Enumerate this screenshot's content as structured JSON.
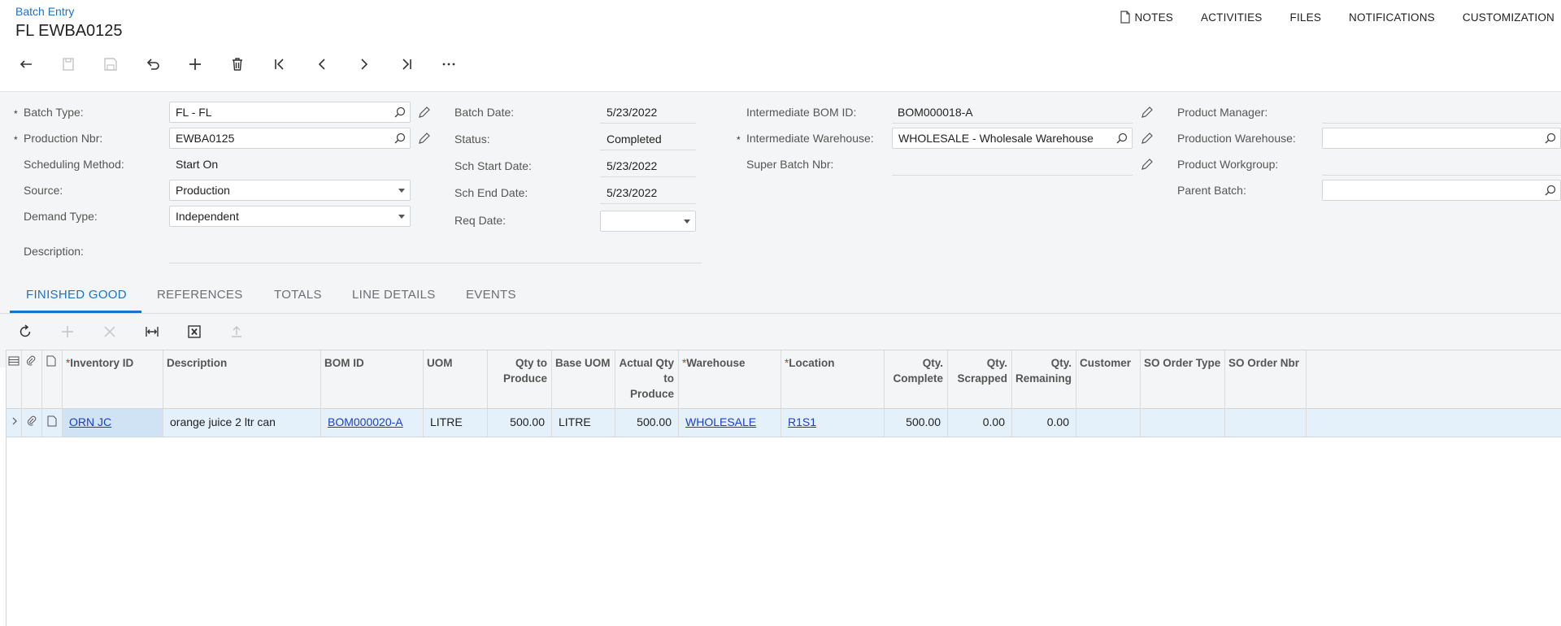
{
  "breadcrumb": "Batch Entry",
  "title": "FL EWBA0125",
  "top_menu": [
    "NOTES",
    "ACTIVITIES",
    "FILES",
    "NOTIFICATIONS",
    "CUSTOMIZATION"
  ],
  "toolbar_icons": [
    "back-icon",
    "copy-icon",
    "save-icon",
    "undo-icon",
    "add-icon",
    "delete-icon",
    "first-icon",
    "previous-icon",
    "next-icon",
    "last-icon",
    "more-icon"
  ],
  "form": {
    "col1": {
      "batch_type": {
        "label": "Batch Type:",
        "value": "FL - FL",
        "required": "*"
      },
      "production_nbr": {
        "label": "Production Nbr:",
        "value": "EWBA0125",
        "required": "*"
      },
      "scheduling_method": {
        "label": "Scheduling Method:",
        "value": "Start On"
      },
      "source": {
        "label": "Source:",
        "value": "Production"
      },
      "demand_type": {
        "label": "Demand Type:",
        "value": "Independent"
      },
      "description": {
        "label": "Description:",
        "value": ""
      }
    },
    "col2": {
      "batch_date": {
        "label": "Batch Date:",
        "value": "5/23/2022"
      },
      "status": {
        "label": "Status:",
        "value": "Completed"
      },
      "sch_start_date": {
        "label": "Sch Start Date:",
        "value": "5/23/2022"
      },
      "sch_end_date": {
        "label": "Sch End Date:",
        "value": "5/23/2022"
      },
      "req_date": {
        "label": "Req Date:",
        "value": ""
      }
    },
    "col3": {
      "intermediate_bom_id": {
        "label": "Intermediate BOM ID:",
        "value": "BOM000018-A"
      },
      "intermediate_warehouse": {
        "label": "Intermediate Warehouse:",
        "value": "WHOLESALE - Wholesale Warehouse",
        "required": "*"
      },
      "super_batch_nbr": {
        "label": "Super Batch Nbr:",
        "value": ""
      }
    },
    "col4": {
      "product_manager": {
        "label": "Product Manager:",
        "value": ""
      },
      "production_warehouse": {
        "label": "Production Warehouse:",
        "value": ""
      },
      "product_workgroup": {
        "label": "Product Workgroup:",
        "value": ""
      },
      "parent_batch": {
        "label": "Parent Batch:",
        "value": ""
      }
    }
  },
  "tabs": [
    "FINISHED GOOD",
    "REFERENCES",
    "TOTALS",
    "LINE DETAILS",
    "EVENTS"
  ],
  "active_tab": "FINISHED GOOD",
  "grid": {
    "columns": [
      {
        "label": "Inventory ID",
        "required": "*"
      },
      {
        "label": "Description"
      },
      {
        "label": "BOM ID"
      },
      {
        "label": "UOM"
      },
      {
        "label": "Qty to Produce"
      },
      {
        "label": "Base UOM"
      },
      {
        "label": "Actual Qty to Produce"
      },
      {
        "label": "Warehouse",
        "required": "*"
      },
      {
        "label": "Location",
        "required": "*"
      },
      {
        "label": "Qty. Complete"
      },
      {
        "label": "Qty. Scrapped"
      },
      {
        "label": "Qty. Remaining"
      },
      {
        "label": "Customer"
      },
      {
        "label": "SO Order Type"
      },
      {
        "label": "SO Order Nbr"
      }
    ],
    "rows": [
      {
        "inventory_id": "ORN JC",
        "description": "orange juice 2 ltr can",
        "bom_id": "BOM000020-A",
        "uom": "LITRE",
        "qty_to_produce": "500.00",
        "base_uom": "LITRE",
        "actual_qty": "500.00",
        "warehouse": "WHOLESALE",
        "location": "R1S1",
        "qty_complete": "500.00",
        "qty_scrapped": "0.00",
        "qty_remaining": "0.00",
        "customer": "",
        "so_order_type": "",
        "so_order_nbr": ""
      }
    ]
  },
  "colors": {
    "accent": "#1a73c7",
    "link": "#1a3dcf",
    "required": "#d32f2f",
    "row_selected": "#e4f0fa"
  }
}
